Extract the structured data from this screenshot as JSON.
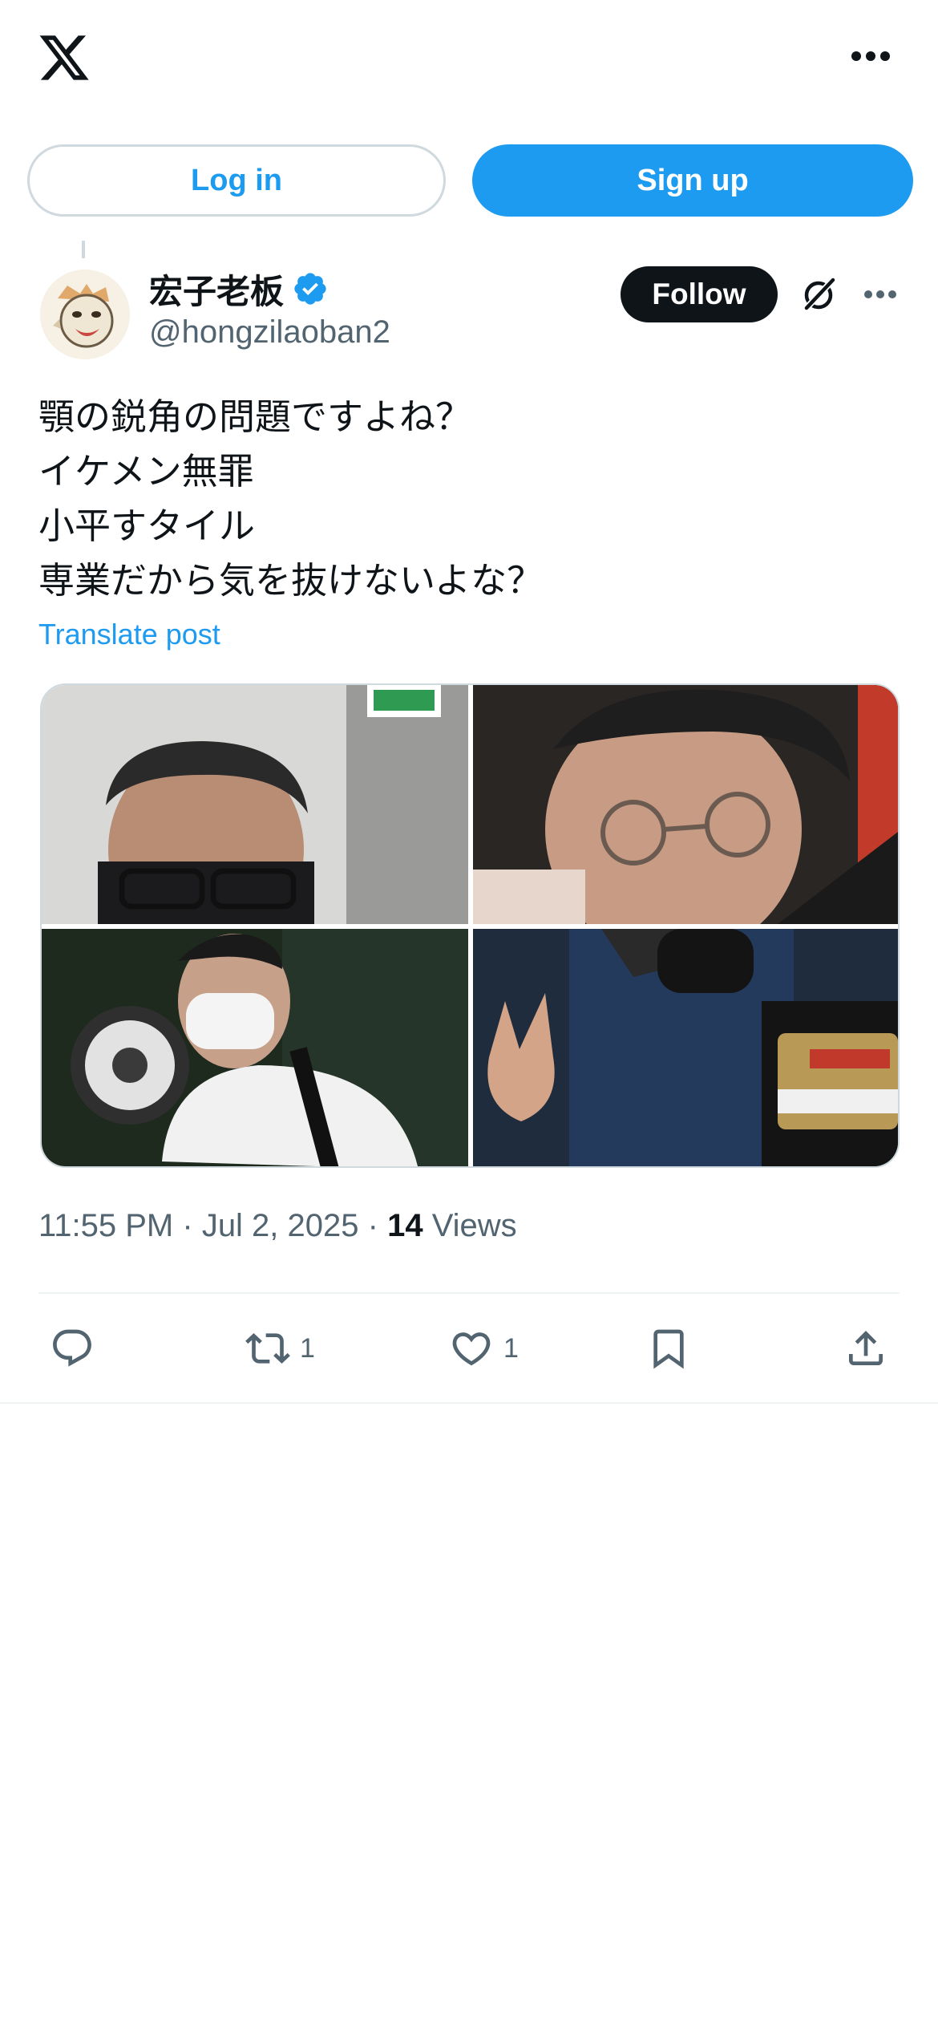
{
  "header": {
    "logo_icon": "x-logo-icon",
    "more_icon": "more-horizontal-icon"
  },
  "auth": {
    "login_label": "Log in",
    "signup_label": "Sign up"
  },
  "tweet": {
    "display_name": "宏子老板",
    "handle": "@hongzilaoban2",
    "verified": true,
    "follow_label": "Follow",
    "text_lines": [
      "顎の鋭角の問題ですよね？",
      "イケメン無罪",
      "小平すタイル",
      "専業だから気を抜けないよな？"
    ],
    "translate_label": "Translate post",
    "photos": [
      "photo-1",
      "photo-2",
      "photo-3",
      "photo-4"
    ],
    "time": "11:55 PM",
    "date": "Jul 2, 2025",
    "views_count": "14",
    "views_label": "Views",
    "stats": {
      "replies": "",
      "reposts": "1",
      "likes": "1"
    }
  },
  "colors": {
    "accent": "#1d9bf0",
    "text": "#0f1419",
    "secondary": "#536471",
    "border": "#cfd9de"
  }
}
